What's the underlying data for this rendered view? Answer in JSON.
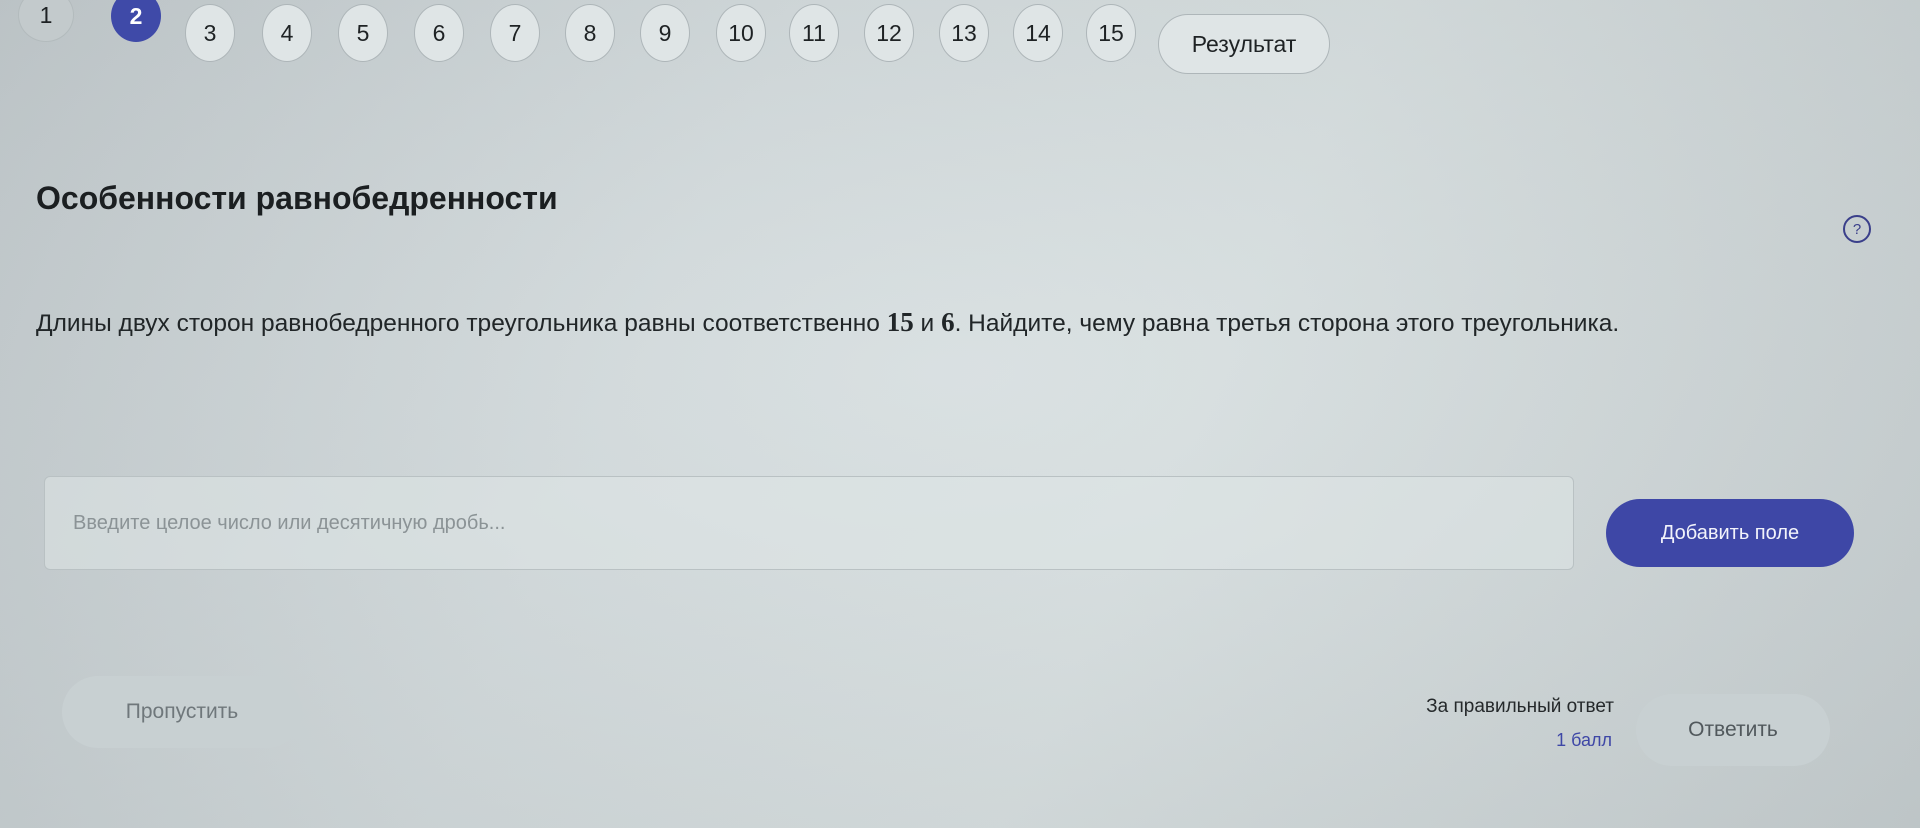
{
  "nav": {
    "questions": [
      "1",
      "2",
      "3",
      "4",
      "5",
      "6",
      "7",
      "8",
      "9",
      "10",
      "11",
      "12",
      "13",
      "14",
      "15"
    ],
    "active_index": 1,
    "result_label": "Результат"
  },
  "task": {
    "title": "Особенности равнобедренности",
    "text_part1": "Длины двух сторон равнобедренного треугольника равны соответственно ",
    "num1": "15",
    "text_part2": " и ",
    "num2": "6",
    "text_part3": ". Найдите, чему равна третья сторона этого треугольника.",
    "help_icon": "question-circle-icon",
    "help_glyph": "?"
  },
  "answer": {
    "placeholder": "Введите целое число или десятичную дробь...",
    "add_field_label": "Добавить поле"
  },
  "footer": {
    "skip_label": "Пропустить",
    "points_label": "За правильный ответ",
    "points_value": "1 балл",
    "answer_label": "Ответить"
  },
  "colors": {
    "accent": "#3e47a6",
    "background": "#d3dbdd",
    "button_muted": "#c8d0d2"
  }
}
